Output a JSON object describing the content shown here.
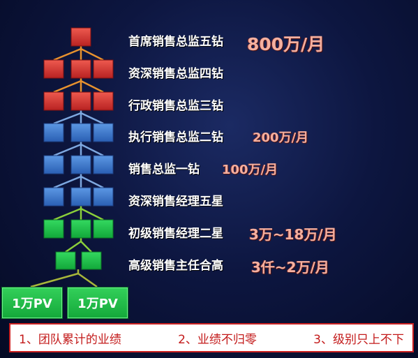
{
  "levels": [
    {
      "title": "首席销售总监五钻",
      "income": "800万/月"
    },
    {
      "title": "资深销售总监四钻",
      "income": ""
    },
    {
      "title": "行政销售总监三钻",
      "income": ""
    },
    {
      "title": "执行销售总监二钻",
      "income": "200万/月"
    },
    {
      "title": "销售总监一钻",
      "income": "100万/月"
    },
    {
      "title": "资深销售经理五星",
      "income": ""
    },
    {
      "title": "初级销售经理二星",
      "income": "3万~18万/月"
    },
    {
      "title": "高级销售主任合高",
      "income": "3仟~2万/月"
    }
  ],
  "pv_boxes": [
    "1万PV",
    "1万PV"
  ],
  "notes": [
    "1、团队累计的业绩",
    "2、业绩不归零",
    "3、级别只上不下"
  ],
  "colors": {
    "red": "#d83a3a",
    "blue": "#3f7fd0",
    "green": "#1fbf4a",
    "line_orange": "#e8922e",
    "line_blue": "#7ea8e0",
    "line_green": "#8bcf3a",
    "line_olive": "#a7b63a"
  }
}
